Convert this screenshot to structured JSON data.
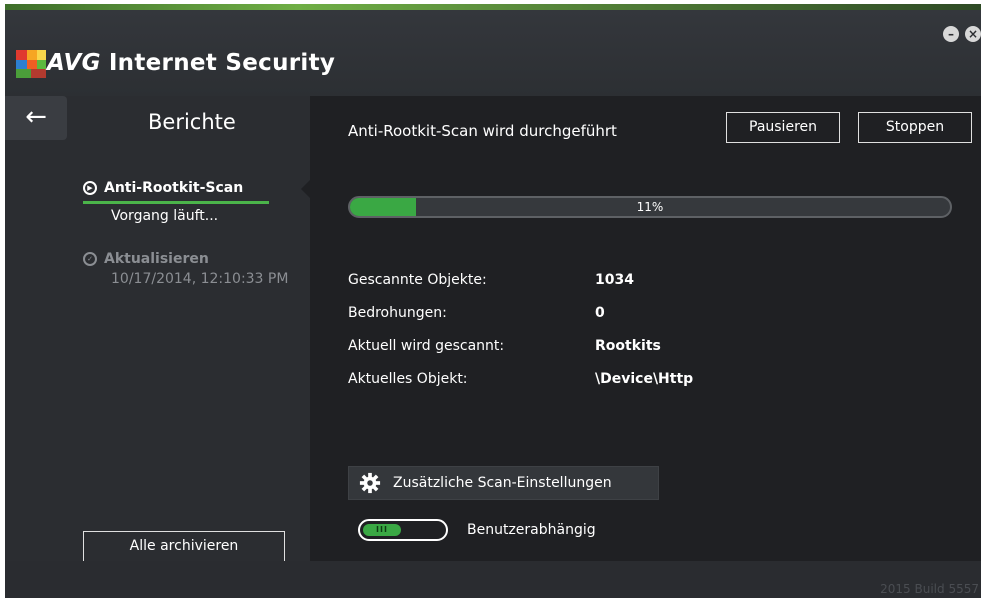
{
  "app": {
    "title_brand": "AVG",
    "title_product": "Internet Security",
    "minimize_glyph": "–",
    "close_glyph": "×",
    "build": "2015 Build 5557",
    "accent_color": "#3aa844"
  },
  "sidebar": {
    "back_glyph": "←",
    "title": "Berichte",
    "items": [
      {
        "label": "Anti-Rootkit-Scan",
        "sub": "Vorgang läuft...",
        "state": "active",
        "icon": "play-circle-icon"
      },
      {
        "label": "Aktualisieren",
        "sub": "10/17/2014, 12:10:33 PM",
        "state": "done",
        "icon": "check-circle-icon"
      }
    ],
    "archive_all": "Alle archivieren"
  },
  "main": {
    "title": "Anti-Rootkit-Scan wird durchgeführt",
    "pause_label": "Pausieren",
    "stop_label": "Stoppen",
    "progress": {
      "percent": 11,
      "text": "11%"
    },
    "stats": [
      {
        "label": "Gescannte Objekte:",
        "value": "1034"
      },
      {
        "label": "Bedrohungen:",
        "value": "0"
      },
      {
        "label": "Aktuell wird gescannt:",
        "value": "Rootkits"
      },
      {
        "label": "Aktuelles Objekt:",
        "value": "\\Device\\Http"
      }
    ],
    "additional_settings": "Zusätzliche Scan-Einstellungen",
    "toggle": {
      "label": "Benutzerabhängig",
      "state": "on",
      "knob_text": "III"
    }
  }
}
